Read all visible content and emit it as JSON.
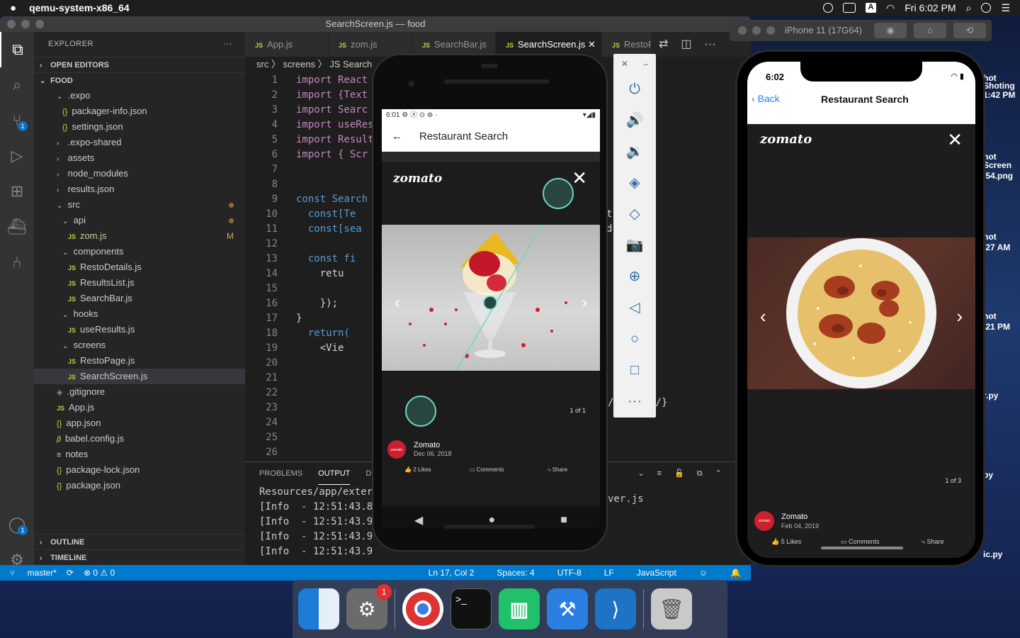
{
  "menubar": {
    "app": "qemu-system-x86_64",
    "clock": "Fri 6:02 PM"
  },
  "desktop_files": [
    "hot",
    "Shoting",
    "1:42 PM",
    "hot",
    "Screen",
    ".54.png",
    "hot",
    ".27 AM",
    "hot",
    ".21 PM",
    "r.py",
    "py",
    "ic.py"
  ],
  "vscode": {
    "title": "SearchScreen.js — food",
    "explorer_label": "EXPLORER",
    "open_editors": "OPEN EDITORS",
    "project": "FOOD",
    "tree": [
      {
        "label": ".expo",
        "type": "folder",
        "indent": 1
      },
      {
        "label": "packager-info.json",
        "type": "json",
        "indent": 2
      },
      {
        "label": "settings.json",
        "type": "json",
        "indent": 2
      },
      {
        "label": ".expo-shared",
        "type": "folder-closed",
        "indent": 1
      },
      {
        "label": "assets",
        "type": "folder-closed",
        "indent": 1
      },
      {
        "label": "node_modules",
        "type": "folder-closed",
        "indent": 1
      },
      {
        "label": "results.json",
        "type": "folder-closed",
        "indent": 1
      },
      {
        "label": "src",
        "type": "folder",
        "indent": 1
      },
      {
        "label": "api",
        "type": "folder",
        "indent": 2
      },
      {
        "label": "zom.js",
        "type": "js",
        "indent": 3
      },
      {
        "label": "components",
        "type": "folder",
        "indent": 2
      },
      {
        "label": "RestoDetails.js",
        "type": "js",
        "indent": 3
      },
      {
        "label": "ResultsList.js",
        "type": "js",
        "indent": 3
      },
      {
        "label": "SearchBar.js",
        "type": "js",
        "indent": 3
      },
      {
        "label": "hooks",
        "type": "folder",
        "indent": 2
      },
      {
        "label": "useResults.js",
        "type": "js",
        "indent": 3
      },
      {
        "label": "screens",
        "type": "folder",
        "indent": 2
      },
      {
        "label": "RestoPage.js",
        "type": "js",
        "indent": 3
      },
      {
        "label": "SearchScreen.js",
        "type": "js",
        "indent": 3
      },
      {
        "label": ".gitignore",
        "type": "git",
        "indent": 1
      },
      {
        "label": "App.js",
        "type": "js",
        "indent": 1
      },
      {
        "label": "app.json",
        "type": "json",
        "indent": 1
      },
      {
        "label": "babel.config.js",
        "type": "babel",
        "indent": 1
      },
      {
        "label": "notes",
        "type": "text",
        "indent": 1
      },
      {
        "label": "package-lock.json",
        "type": "json",
        "indent": 1
      },
      {
        "label": "package.json",
        "type": "json",
        "indent": 1
      }
    ],
    "modified_tag": "M",
    "outline": "OUTLINE",
    "timeline": "TIMELINE",
    "tabs": [
      "App.js",
      "zom.js",
      "SearchBar.js",
      "SearchScreen.js",
      "RestoP"
    ],
    "breadcrumb": "src 〉 screens 〉 JS Search",
    "code_lines": [
      "import React",
      "import {Text",
      "import Searc",
      "import useRes",
      "import Result",
      "import { Scr",
      "",
      "",
      "const Search",
      "  const[Te",
      "  const[sea",
      "",
      "  const fi",
      "    retu",
      "",
      "    });",
      "}",
      "  return(",
      "    <Vie",
      "",
      "",
      "",
      "",
      "",
      "",
      ""
    ],
    "right_fragments": {
      "l21": "d",
      "l24": "t",
      "l39": "/Text> */}"
    },
    "panel_tabs": [
      "PROBLEMS",
      "OUTPUT",
      "DE"
    ],
    "panel_fragment": "ver.js",
    "log_lines": [
      "Resources/app/exter",
      "[Info  - 12:51:43.8",
      "[Info  - 12:51:43.9",
      "[Info  - 12:51:43.9",
      "[Info  - 12:51:43.9"
    ],
    "status": {
      "branch": "master*",
      "problems": "⊗ 0 ⚠ 0",
      "position": "Ln 17, Col 2",
      "spaces": "Spaces: 4",
      "encoding": "UTF-8",
      "eol": "LF",
      "language": "JavaScript"
    }
  },
  "android": {
    "time": "6:01",
    "title": "Restaurant Search",
    "brand": "zomato",
    "counter": "1 of 1",
    "poster": "Zomato",
    "date": "Dec 06, 2018",
    "likes": "2 Likes",
    "comments": "Comments",
    "share": "Share"
  },
  "iphone": {
    "device": "iPhone 11 (17G64)",
    "time": "6:02",
    "back": "Back",
    "title": "Restaurant Search",
    "brand": "zomato",
    "counter": "1 of 3",
    "poster": "Zomato",
    "date": "Feb 04, 2019",
    "likes": "5 Likes",
    "comments": "Comments",
    "share": "Share"
  },
  "dock": {
    "badge": "1"
  }
}
